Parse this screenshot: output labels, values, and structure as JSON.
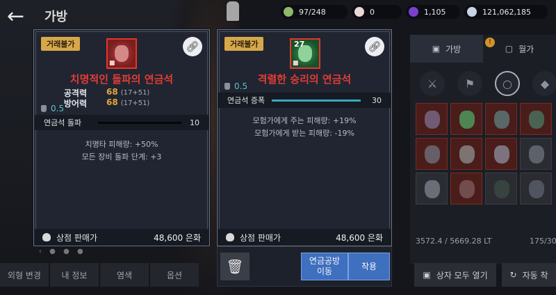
{
  "header": {
    "back_icon": "back-arrow-icon",
    "title": "가방"
  },
  "currencies": [
    {
      "icon": "gem-stack-icon",
      "color": "#8fb86a",
      "value": "97/248"
    },
    {
      "icon": "pearl-icon",
      "color": "#e8d8d8",
      "value": "0"
    },
    {
      "icon": "purple-orb-icon",
      "color": "#7b3fd0",
      "value": "1,105"
    },
    {
      "icon": "silver-coin-icon",
      "color": "#c8d4e4",
      "value": "121,062,185"
    }
  ],
  "inventory": {
    "tabs": [
      "가방",
      "월가"
    ],
    "lt_text": "3572.4 / 5669.28 LT",
    "slots_text": "175/30",
    "open_all_label": "상자 모두 열기",
    "auto_label": "자동 착"
  },
  "left_nav": [
    "외형 변경",
    "내 정보",
    "염색",
    "옵션"
  ],
  "item_left": {
    "tag": "거래불가",
    "name": "치명적인 돌파의 연금석",
    "stats": [
      {
        "label": "공격력",
        "value": "68",
        "sub": "(17+51)"
      },
      {
        "label": "방어력",
        "value": "68",
        "sub": "(17+51)"
      }
    ],
    "weight": "0.5",
    "bar_label": "연금석 돌파",
    "bar_value": "10",
    "bar_fill": 1.0,
    "effects": [
      "치명타 피해량: +50%",
      "모든 장비 돌파 단계: +3"
    ],
    "sell_label": "상점 판매가",
    "sell_price": "48,600 은화"
  },
  "item_right": {
    "tag": "거래불가",
    "stack": "27",
    "name": "격렬한 승리의 연금석",
    "weight": "0.5",
    "bar_label": "연금석 증폭",
    "bar_value": "30",
    "bar_fill": 1.0,
    "effects": [
      "모험가에게 주는 피해량: +19%",
      "모험가에게 받는 피해량: -19%"
    ],
    "sell_label": "상점 판매가",
    "sell_price": "48,600 은화"
  },
  "actions": {
    "trash_icon": "trash-icon",
    "move_label_1": "연금공방",
    "move_label_2": "이동",
    "equip_label": "착용"
  }
}
